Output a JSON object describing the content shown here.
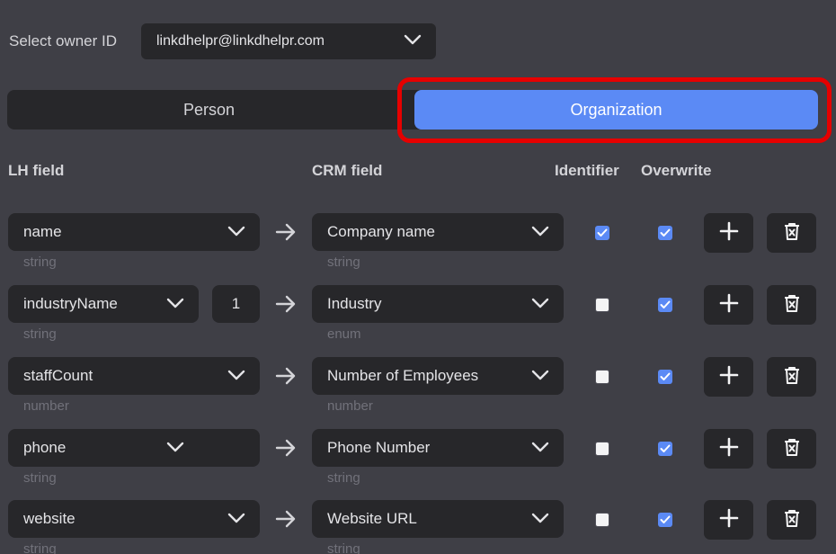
{
  "owner": {
    "label": "Select owner ID",
    "value": "linkdhelpr@linkdhelpr.com"
  },
  "tabs": [
    {
      "label": "Person",
      "active": false
    },
    {
      "label": "Organization",
      "active": true
    }
  ],
  "columns": {
    "lh_field": "LH field",
    "crm_field": "CRM field",
    "identifier": "Identifier",
    "overwrite": "Overwrite"
  },
  "rows": [
    {
      "lh_field": "name",
      "lh_type": "string",
      "index": null,
      "crm_field": "Company name",
      "crm_type": "string",
      "identifier": true,
      "overwrite": true
    },
    {
      "lh_field": "industryName",
      "lh_type": "string",
      "index": "1",
      "crm_field": "Industry",
      "crm_type": "enum",
      "identifier": false,
      "overwrite": true
    },
    {
      "lh_field": "staffCount",
      "lh_type": "number",
      "index": null,
      "crm_field": "Number of Employees",
      "crm_type": "number",
      "identifier": false,
      "overwrite": true
    },
    {
      "lh_field": "phone",
      "lh_type": "string",
      "index": null,
      "crm_field": "Phone Number",
      "crm_type": "string",
      "identifier": false,
      "overwrite": true
    },
    {
      "lh_field": "website",
      "lh_type": "string",
      "index": null,
      "crm_field": "Website URL",
      "crm_type": "string",
      "identifier": false,
      "overwrite": true
    }
  ],
  "colors": {
    "background": "#3f3f46",
    "control": "#27272a",
    "accent": "#5b8af5",
    "highlight": "#e60000"
  },
  "icons": {
    "dropdown": "chevron-down-icon",
    "mapping": "arrow-right-icon",
    "add": "plus-icon",
    "delete": "trash-icon"
  }
}
